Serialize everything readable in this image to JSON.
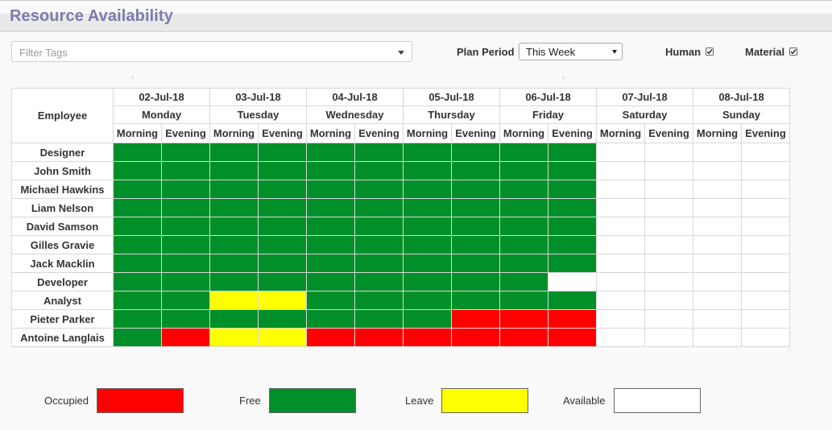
{
  "header": {
    "title": "Resource Availability"
  },
  "filter": {
    "placeholder": "Filter Tags"
  },
  "plan_period": {
    "label": "Plan Period",
    "selected": "This Week"
  },
  "toggles": [
    {
      "label": "Human",
      "checked": true
    },
    {
      "label": "Material",
      "checked": true
    }
  ],
  "table": {
    "employee_header": "Employee",
    "days": [
      {
        "date": "02-Jul-18",
        "day": "Monday"
      },
      {
        "date": "03-Jul-18",
        "day": "Tuesday"
      },
      {
        "date": "04-Jul-18",
        "day": "Wednesday"
      },
      {
        "date": "05-Jul-18",
        "day": "Thursday"
      },
      {
        "date": "06-Jul-18",
        "day": "Friday"
      },
      {
        "date": "07-Jul-18",
        "day": "Saturday"
      },
      {
        "date": "08-Jul-18",
        "day": "Sunday"
      }
    ],
    "shifts": [
      "Morning",
      "Evening"
    ],
    "rows": [
      {
        "name": "Designer",
        "slots": [
          "free",
          "free",
          "free",
          "free",
          "free",
          "free",
          "free",
          "free",
          "free",
          "free",
          "available",
          "available",
          "available",
          "available"
        ]
      },
      {
        "name": "John Smith",
        "slots": [
          "free",
          "free",
          "free",
          "free",
          "free",
          "free",
          "free",
          "free",
          "free",
          "free",
          "available",
          "available",
          "available",
          "available"
        ]
      },
      {
        "name": "Michael Hawkins",
        "slots": [
          "free",
          "free",
          "free",
          "free",
          "free",
          "free",
          "free",
          "free",
          "free",
          "free",
          "available",
          "available",
          "available",
          "available"
        ]
      },
      {
        "name": "Liam Nelson",
        "slots": [
          "free",
          "free",
          "free",
          "free",
          "free",
          "free",
          "free",
          "free",
          "free",
          "free",
          "available",
          "available",
          "available",
          "available"
        ]
      },
      {
        "name": "David Samson",
        "slots": [
          "free",
          "free",
          "free",
          "free",
          "free",
          "free",
          "free",
          "free",
          "free",
          "free",
          "available",
          "available",
          "available",
          "available"
        ]
      },
      {
        "name": "Gilles Gravie",
        "slots": [
          "free",
          "free",
          "free",
          "free",
          "free",
          "free",
          "free",
          "free",
          "free",
          "free",
          "available",
          "available",
          "available",
          "available"
        ]
      },
      {
        "name": "Jack Macklin",
        "slots": [
          "free",
          "free",
          "free",
          "free",
          "free",
          "free",
          "free",
          "free",
          "free",
          "free",
          "available",
          "available",
          "available",
          "available"
        ]
      },
      {
        "name": "Developer",
        "slots": [
          "free",
          "free",
          "free",
          "free",
          "free",
          "free",
          "free",
          "free",
          "free",
          "available",
          "available",
          "available",
          "available",
          "available"
        ]
      },
      {
        "name": "Analyst",
        "slots": [
          "free",
          "free",
          "leave",
          "leave",
          "free",
          "free",
          "free",
          "free",
          "free",
          "free",
          "available",
          "available",
          "available",
          "available"
        ]
      },
      {
        "name": "Pieter Parker",
        "slots": [
          "free",
          "free",
          "free",
          "free",
          "free",
          "free",
          "free",
          "occupied",
          "occupied",
          "occupied",
          "available",
          "available",
          "available",
          "available"
        ]
      },
      {
        "name": "Antoine Langlais",
        "slots": [
          "free",
          "occupied",
          "leave",
          "leave",
          "occupied",
          "occupied",
          "occupied",
          "occupied",
          "occupied",
          "occupied",
          "available",
          "available",
          "available",
          "available"
        ]
      }
    ]
  },
  "legend": [
    {
      "key": "occupied",
      "label": "Occupied",
      "color": "#ff0000"
    },
    {
      "key": "free",
      "label": "Free",
      "color": "#008f28"
    },
    {
      "key": "leave",
      "label": "Leave",
      "color": "#ffff00"
    },
    {
      "key": "available",
      "label": "Available",
      "color": "#ffffff"
    }
  ]
}
